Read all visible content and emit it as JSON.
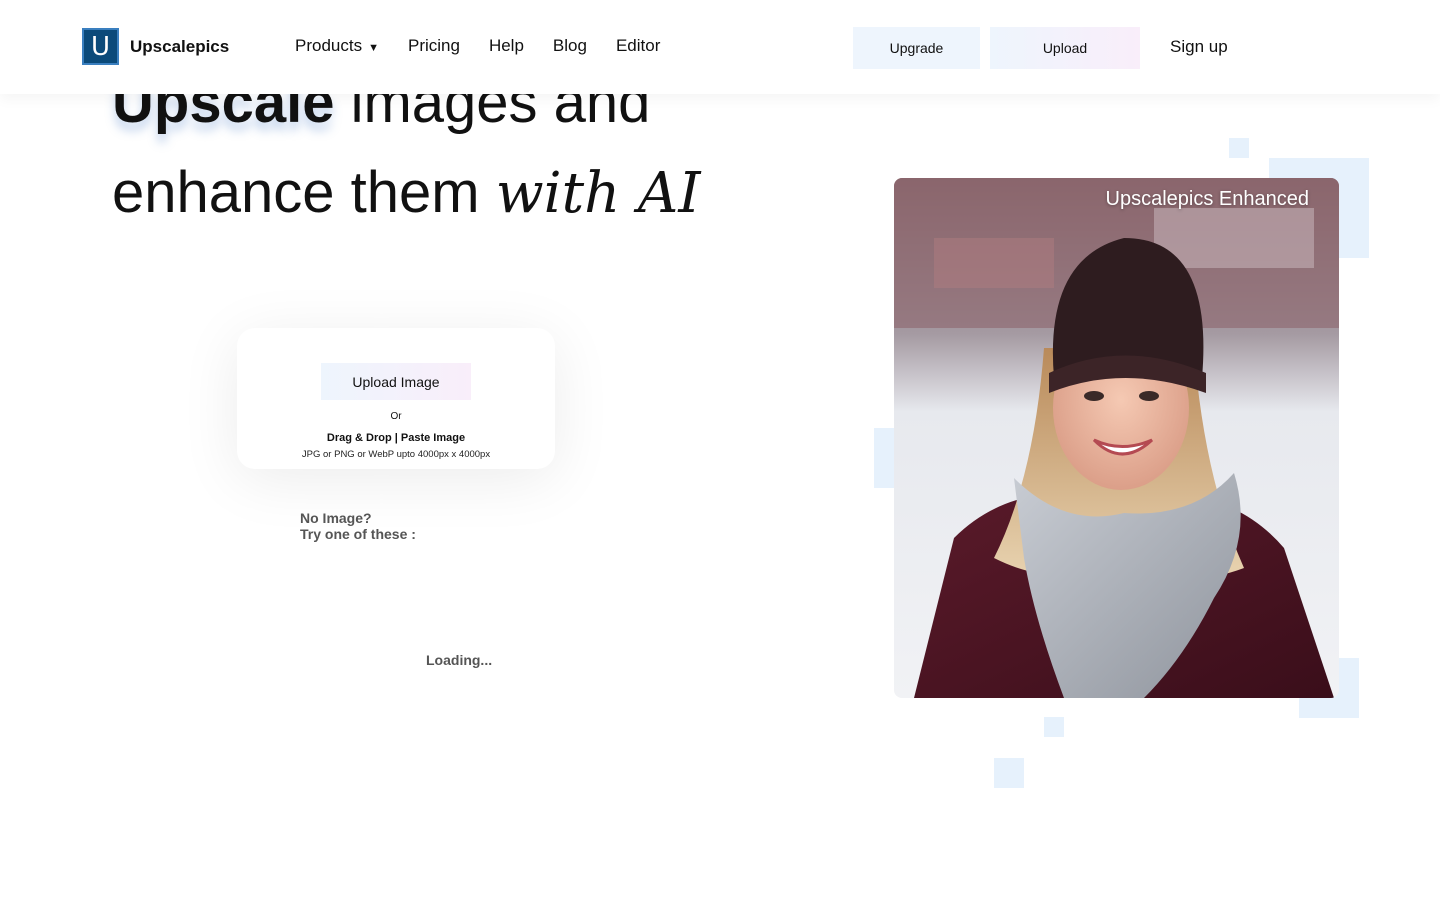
{
  "brand": {
    "logo_letter": "U",
    "name": "Upscalepics"
  },
  "nav": {
    "products": "Products",
    "products_caret": "▼",
    "pricing": "Pricing",
    "help": "Help",
    "blog": "Blog",
    "editor": "Editor"
  },
  "header_actions": {
    "upgrade": "Upgrade",
    "upload": "Upload",
    "signup": "Sign up"
  },
  "hero": {
    "line1_bold": "Upscale",
    "line1_rest": " images and",
    "line2_plain": "enhance them ",
    "line2_script": "with AI"
  },
  "upload_card": {
    "button": "Upload Image",
    "or": "Or",
    "drag_drop": "Drag & Drop | Paste Image",
    "formats": "JPG or PNG or WebP upto 4000px x 4000px"
  },
  "samples": {
    "line1": "No Image?",
    "line2": "Try one of these :",
    "loading": "Loading..."
  },
  "preview": {
    "caption": "Upscalepics Enhanced"
  },
  "colors": {
    "accent": "#0b4a7a",
    "button_bg": "#eef5fd",
    "decor": "#e6f1fc"
  }
}
